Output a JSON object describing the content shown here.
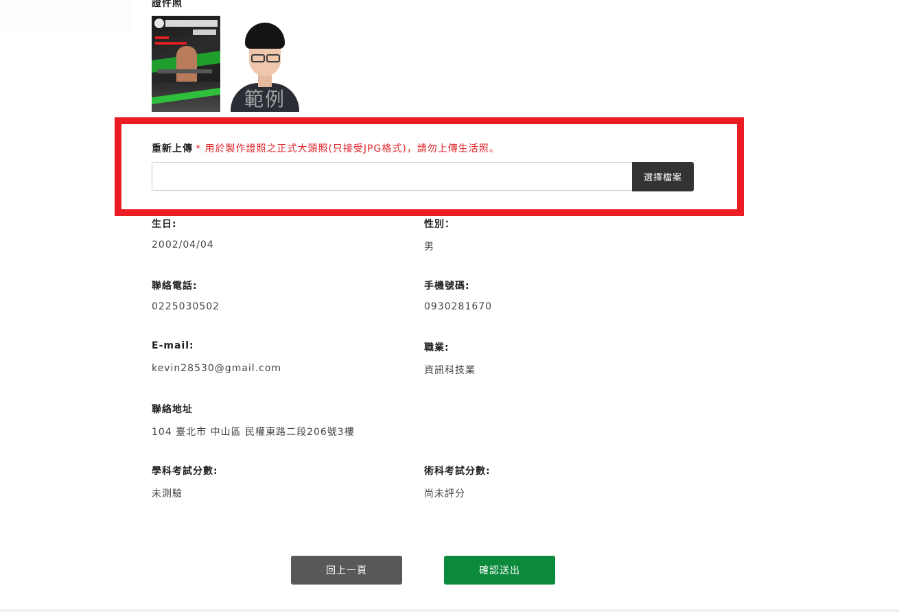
{
  "photos": {
    "section_label": "證件照",
    "sample_watermark": "範例"
  },
  "upload": {
    "label": "重新上傳",
    "hint": "* 用於製作證照之正式大頭照(只接受JPG格式)，請勿上傳生活照。",
    "input_value": "",
    "button_label": "選擇檔案"
  },
  "fields": {
    "birthday": {
      "label": "生日:",
      "value": "2002/04/04"
    },
    "gender": {
      "label": "性別：",
      "value": "男"
    },
    "phone": {
      "label": "聯絡電話:",
      "value": "0225030502"
    },
    "mobile": {
      "label": "手機號碼:",
      "value": "0930281670"
    },
    "email": {
      "label": "E-mail:",
      "value": "kevin28530@gmail.com"
    },
    "occupation": {
      "label": "職業:",
      "value": "資訊科技業"
    },
    "address": {
      "label": "聯絡地址",
      "value": "104 臺北市 中山區 民權東路二段206號3樓"
    },
    "written_score": {
      "label": "學科考試分數:",
      "value": "未測驗"
    },
    "practical_score": {
      "label": "術科考試分數:",
      "value": "尚未評分"
    }
  },
  "actions": {
    "back_label": "回上一頁",
    "submit_label": "確認送出"
  },
  "colors": {
    "highlight": "#ec1c24",
    "hint_text": "#e01f26",
    "submit": "#0b8a3b",
    "back": "#58585a",
    "file_button": "#333333"
  }
}
